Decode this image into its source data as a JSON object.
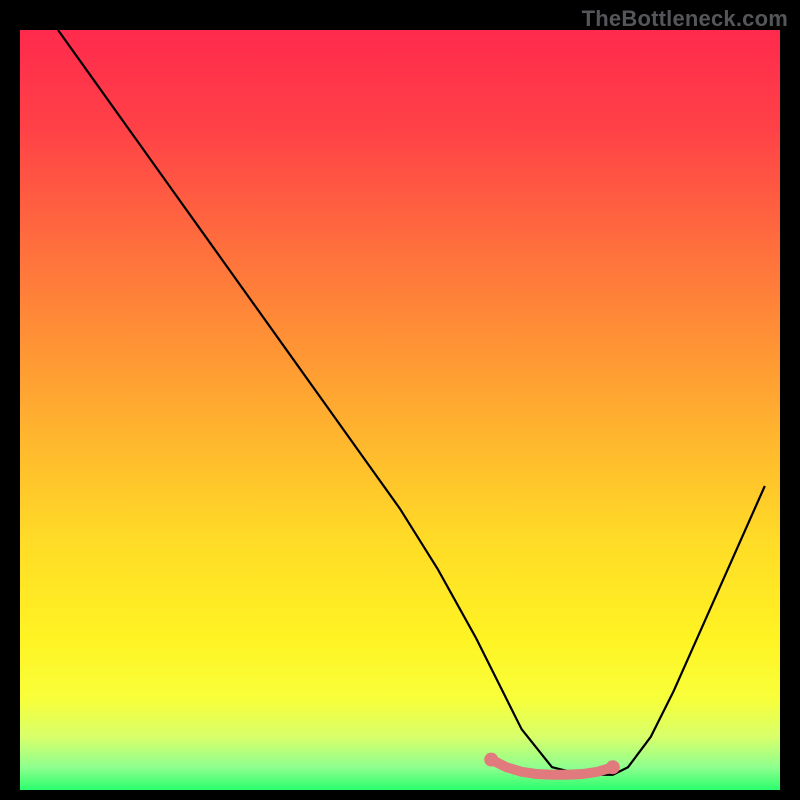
{
  "watermark": "TheBottleneck.com",
  "chart_data": {
    "type": "line",
    "title": "",
    "xlabel": "",
    "ylabel": "",
    "xlim": [
      0,
      100
    ],
    "ylim": [
      0,
      100
    ],
    "grid": false,
    "legend": false,
    "gradient_stops": [
      {
        "offset": 0.0,
        "color": "#ff2a4d"
      },
      {
        "offset": 0.13,
        "color": "#ff4147"
      },
      {
        "offset": 0.27,
        "color": "#ff6a3e"
      },
      {
        "offset": 0.4,
        "color": "#ff8f36"
      },
      {
        "offset": 0.53,
        "color": "#ffb42e"
      },
      {
        "offset": 0.67,
        "color": "#ffdb27"
      },
      {
        "offset": 0.8,
        "color": "#fff323"
      },
      {
        "offset": 0.88,
        "color": "#f8ff3a"
      },
      {
        "offset": 0.93,
        "color": "#d8ff6a"
      },
      {
        "offset": 0.97,
        "color": "#8fff8f"
      },
      {
        "offset": 1.0,
        "color": "#2aff6e"
      }
    ],
    "series": [
      {
        "name": "bottleneck-curve",
        "color": "#000000",
        "x": [
          5,
          10,
          15,
          20,
          25,
          30,
          35,
          40,
          45,
          50,
          55,
          60,
          62,
          64,
          66,
          70,
          74,
          76,
          78,
          80,
          83,
          86,
          90,
          94,
          98
        ],
        "y": [
          100,
          93,
          86,
          79,
          72,
          65,
          58,
          51,
          44,
          37,
          29,
          20,
          16,
          12,
          8,
          3,
          2,
          2,
          2,
          3,
          7,
          13,
          22,
          31,
          40
        ]
      }
    ],
    "highlight": {
      "name": "optimal-range-marker",
      "color": "#e07a7c",
      "x": [
        62,
        64,
        66,
        68,
        70,
        72,
        74,
        76,
        78
      ],
      "y": [
        4.0,
        3.0,
        2.4,
        2.1,
        2.0,
        2.0,
        2.1,
        2.4,
        3.0
      ],
      "endpoints": [
        {
          "x": 62,
          "y": 4.0
        },
        {
          "x": 78,
          "y": 3.0
        }
      ]
    }
  }
}
